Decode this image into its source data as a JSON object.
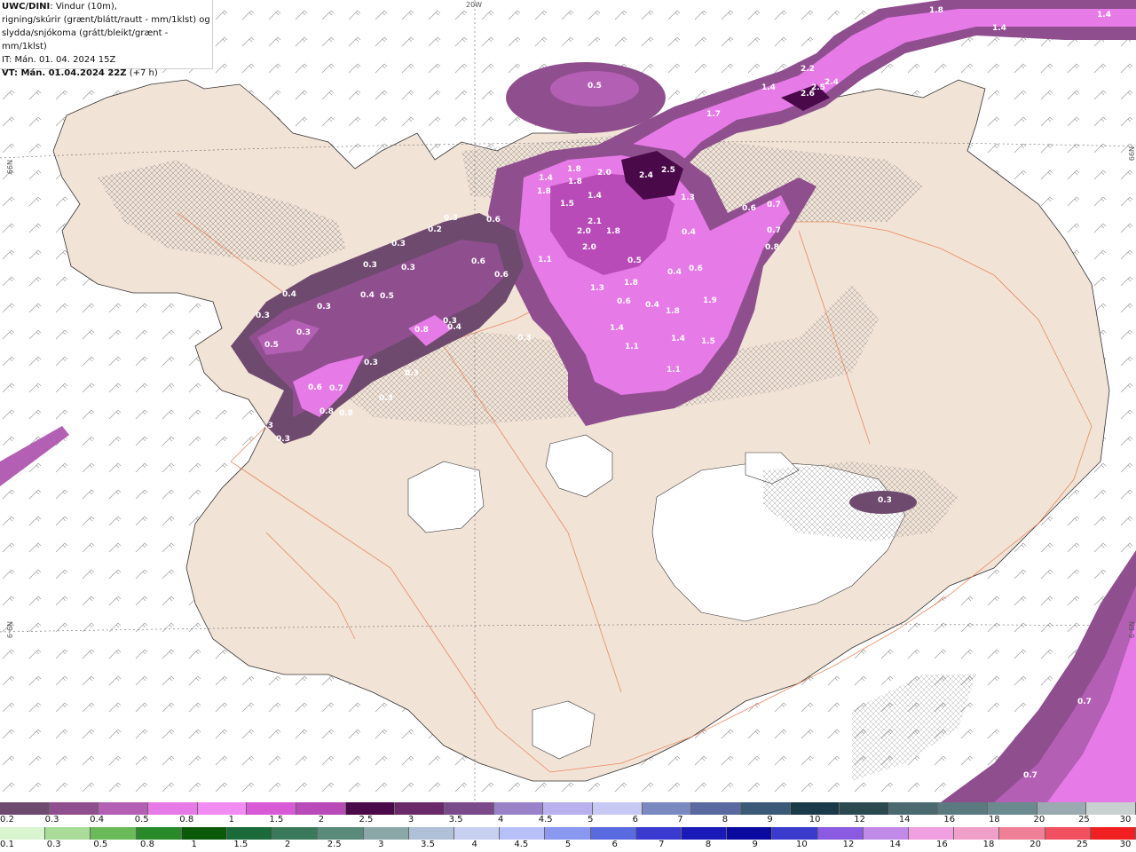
{
  "header": {
    "model": "UWC/DINI",
    "line1_rest": ": Vindur (10m),",
    "line2": "rigning/skúrir (grænt/blátt/rautt - mm/1klst) og",
    "line3": "slydda/snjókoma (grátt/bleikt/grænt - mm/1klst)",
    "line4": "IT: Mán. 01. 04. 2024 15Z",
    "vt_label": "VT: Mán. 01.04.2024 22Z",
    "vt_offset": " (+7 h)"
  },
  "grid_labels": {
    "top_lon": "20W",
    "left_lat_upper": "N99",
    "left_lat_lower": "N9-9",
    "right_lat_upper": "N99",
    "right_lat_lower": "N9-9"
  },
  "precip_values": [
    {
      "text": "1.8"
    },
    {
      "text": "1.4"
    },
    {
      "text": "1.4"
    },
    {
      "text": "0.5"
    },
    {
      "text": "2.2"
    },
    {
      "text": "2.4"
    },
    {
      "text": "2.5"
    },
    {
      "text": "2.6"
    },
    {
      "text": "1.4"
    },
    {
      "text": "1.7"
    },
    {
      "text": "1.8"
    },
    {
      "text": "2.0"
    },
    {
      "text": "1.4"
    },
    {
      "text": "1.8"
    },
    {
      "text": "1.8"
    },
    {
      "text": "2.4"
    },
    {
      "text": "2.5"
    },
    {
      "text": "1.3"
    },
    {
      "text": "1.5"
    },
    {
      "text": "1.4"
    },
    {
      "text": "2.1"
    },
    {
      "text": "2.0"
    },
    {
      "text": "1.8"
    },
    {
      "text": "2.0"
    },
    {
      "text": "0.3"
    },
    {
      "text": "0.6"
    },
    {
      "text": "0.2"
    },
    {
      "text": "0.3"
    },
    {
      "text": "0.6"
    },
    {
      "text": "0.7"
    },
    {
      "text": "0.7"
    },
    {
      "text": "0.8"
    },
    {
      "text": "0.4"
    },
    {
      "text": "0.3"
    },
    {
      "text": "0.3"
    },
    {
      "text": "0.6"
    },
    {
      "text": "1.1"
    },
    {
      "text": "0.6"
    },
    {
      "text": "0.5"
    },
    {
      "text": "0.4"
    },
    {
      "text": "0.6"
    },
    {
      "text": "1.3"
    },
    {
      "text": "1.8"
    },
    {
      "text": "0.6"
    },
    {
      "text": "1.8"
    },
    {
      "text": "1.9"
    },
    {
      "text": "0.4"
    },
    {
      "text": "0.5"
    },
    {
      "text": "0.4"
    },
    {
      "text": "0.3"
    },
    {
      "text": "0.3"
    },
    {
      "text": "0.5"
    },
    {
      "text": "0.3"
    },
    {
      "text": "0.4"
    },
    {
      "text": "0.8"
    },
    {
      "text": "0.3"
    },
    {
      "text": "0.4"
    },
    {
      "text": "0.3"
    },
    {
      "text": "1.4"
    },
    {
      "text": "1.4"
    },
    {
      "text": "1.5"
    },
    {
      "text": "1.1"
    },
    {
      "text": "1.1"
    },
    {
      "text": "0.3"
    },
    {
      "text": "0.3"
    },
    {
      "text": "0.6"
    },
    {
      "text": "0.7"
    },
    {
      "text": "0.8"
    },
    {
      "text": "0.8"
    },
    {
      "text": "0.3"
    },
    {
      "text": "0.3"
    },
    {
      "text": "0.3"
    },
    {
      "text": "0.3"
    },
    {
      "text": "0.7"
    },
    {
      "text": "0.7"
    }
  ],
  "legend": {
    "snow": {
      "colors": [
        "#6e4a6e",
        "#8f4f8f",
        "#b35fb3",
        "#e67ae6",
        "#f28cf2",
        "#d75ad7",
        "#b84bb8",
        "#4a0a4a",
        "#6a2a6a",
        "#7a4a8a",
        "#9a82c8",
        "#b9b0ee",
        "#c8c8f5",
        "#7a8ac0",
        "#5a6aa0",
        "#3a5a78",
        "#1a3a4a",
        "#2a4a50",
        "#4a6a70",
        "#5a7a80",
        "#6a8a90",
        "#9aaab0",
        "#c8d0d0"
      ],
      "labels": [
        "0.2",
        "0.3",
        "0.4",
        "0.5",
        "0.8",
        "1",
        "1.5",
        "2",
        "2.5",
        "3",
        "3.5",
        "4",
        "4.5",
        "5",
        "6",
        "7",
        "8",
        "9",
        "10",
        "12",
        "14",
        "16",
        "18",
        "20",
        "25",
        "30"
      ]
    },
    "rain": {
      "colors": [
        "#d8f5d0",
        "#a8dc98",
        "#6aba5a",
        "#2a8a2a",
        "#0a5a0a",
        "#1a6a3a",
        "#3a7a5a",
        "#5a8a7a",
        "#8aa8a8",
        "#b0c0d8",
        "#c8d0f0",
        "#b8c0f8",
        "#8a98f0",
        "#5a6ae0",
        "#3a3ad0",
        "#1a1ab8",
        "#0a0aa0",
        "#3a3acc",
        "#8a5ae0",
        "#c08ae8",
        "#f0a0e0",
        "#f0a0c8",
        "#f08098",
        "#f05060",
        "#f02020"
      ],
      "labels": [
        "0.1",
        "0.3",
        "0.5",
        "0.8",
        "1",
        "1.5",
        "2",
        "2.5",
        "3",
        "3.5",
        "4",
        "4.5",
        "5",
        "6",
        "7",
        "8",
        "9",
        "10",
        "12",
        "14",
        "16",
        "18",
        "20",
        "25",
        "30"
      ]
    }
  }
}
